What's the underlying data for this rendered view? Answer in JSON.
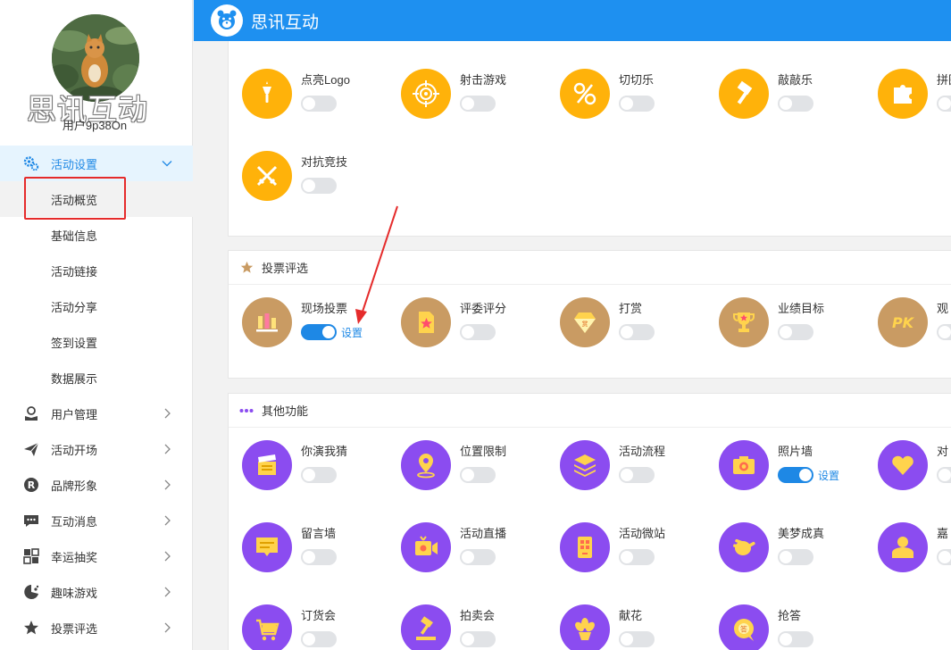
{
  "header": {
    "brand": "思讯互动"
  },
  "profile": {
    "watermark": "思讯互动",
    "username": "用户9p38On"
  },
  "sidebar": {
    "active_group": {
      "label": "活动设置",
      "icon": "gears-icon"
    },
    "sub_items": [
      "活动概览",
      "基础信息",
      "活动链接",
      "活动分享",
      "签到设置",
      "数据展示"
    ],
    "groups": [
      {
        "label": "用户管理",
        "icon": "user-icon"
      },
      {
        "label": "活动开场",
        "icon": "send-icon"
      },
      {
        "label": "品牌形象",
        "icon": "registered-icon"
      },
      {
        "label": "互动消息",
        "icon": "chat-icon"
      },
      {
        "label": "幸运抽奖",
        "icon": "lottery-icon"
      },
      {
        "label": "趣味游戏",
        "icon": "game-icon"
      },
      {
        "label": "投票评选",
        "icon": "star-icon"
      }
    ]
  },
  "games": {
    "items": [
      {
        "label": "点亮Logo",
        "on": false,
        "icon": "torch-icon"
      },
      {
        "label": "射击游戏",
        "on": false,
        "icon": "target-icon"
      },
      {
        "label": "切切乐",
        "on": false,
        "icon": "fruit-slice-icon"
      },
      {
        "label": "敲敲乐",
        "on": false,
        "icon": "hammer-icon"
      },
      {
        "label": "拼图",
        "on": false,
        "icon": "puzzle-icon"
      },
      {
        "label": "对抗竞技",
        "on": false,
        "icon": "swords-icon"
      }
    ]
  },
  "voting": {
    "title": "投票评选",
    "items": [
      {
        "label": "现场投票",
        "on": true,
        "setting": "设置",
        "icon": "bar-chart-icon"
      },
      {
        "label": "评委评分",
        "on": false,
        "icon": "score-card-icon"
      },
      {
        "label": "打赏",
        "on": false,
        "icon": "diamond-icon"
      },
      {
        "label": "业绩目标",
        "on": false,
        "icon": "trophy-icon"
      },
      {
        "label": "观",
        "on": false,
        "icon": "pk-icon"
      }
    ]
  },
  "others": {
    "title": "其他功能",
    "items": [
      {
        "label": "你演我猜",
        "on": false,
        "icon": "clapperboard-icon"
      },
      {
        "label": "位置限制",
        "on": false,
        "icon": "location-pin-icon"
      },
      {
        "label": "活动流程",
        "on": false,
        "icon": "layers-icon"
      },
      {
        "label": "照片墙",
        "on": true,
        "setting": "设置",
        "icon": "camera-icon"
      },
      {
        "label": "对",
        "on": false,
        "icon": "hearts-icon"
      },
      {
        "label": "留言墙",
        "on": false,
        "icon": "message-board-icon"
      },
      {
        "label": "活动直播",
        "on": false,
        "icon": "video-camera-icon"
      },
      {
        "label": "活动微站",
        "on": false,
        "icon": "microsite-icon"
      },
      {
        "label": "美梦成真",
        "on": false,
        "icon": "hand-wave-icon"
      },
      {
        "label": "嘉",
        "on": false,
        "icon": "guest-icon"
      },
      {
        "label": "订货会",
        "on": false,
        "icon": "cart-icon"
      },
      {
        "label": "拍卖会",
        "on": false,
        "icon": "auction-hammer-icon"
      },
      {
        "label": "献花",
        "on": false,
        "icon": "flower-icon"
      },
      {
        "label": "抢答",
        "on": false,
        "icon": "quiz-icon"
      }
    ]
  },
  "colors": {
    "primary": "#1e90f0",
    "orange": "#ffb20a",
    "brown": "#c99b63",
    "purple": "#8b4cf0",
    "highlight": "#e52b2b"
  }
}
